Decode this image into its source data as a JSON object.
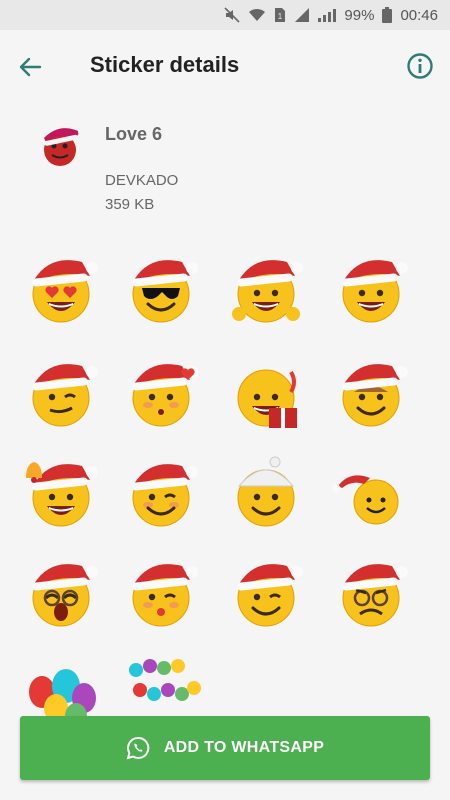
{
  "status_bar": {
    "battery": "99%",
    "time": "00:46"
  },
  "app_bar": {
    "title": "Sticker details"
  },
  "pack": {
    "name": "Love 6",
    "author": "DEVKADO",
    "size": "359 KB"
  },
  "add_button": {
    "label": "ADD TO WHATSAPP"
  },
  "colors": {
    "accent": "#2e7d74",
    "button": "#4caf50",
    "emoji_yellow": "#f7c21b",
    "santa_red": "#d32f2f"
  },
  "stickers": [
    {
      "name": "heart-eyes-santa-hat"
    },
    {
      "name": "sunglasses-santa-hat"
    },
    {
      "name": "thumbs-up-santa-hat"
    },
    {
      "name": "grin-santa-hat"
    },
    {
      "name": "smirk-santa-hat"
    },
    {
      "name": "blush-hearts-santa-hat"
    },
    {
      "name": "gift-hug-emoji"
    },
    {
      "name": "blush-santa-hat"
    },
    {
      "name": "bell-ringing-santa-hat"
    },
    {
      "name": "wink-santa-hat"
    },
    {
      "name": "snow-hat-smile"
    },
    {
      "name": "santa-hat-smile"
    },
    {
      "name": "crying-laugh-santa-hat"
    },
    {
      "name": "kiss-santa-hat"
    },
    {
      "name": "wink-santa-hat-2"
    },
    {
      "name": "angry-glasses-santa-hat"
    },
    {
      "name": "balloons"
    },
    {
      "name": "happy-birthday-balloons"
    }
  ]
}
